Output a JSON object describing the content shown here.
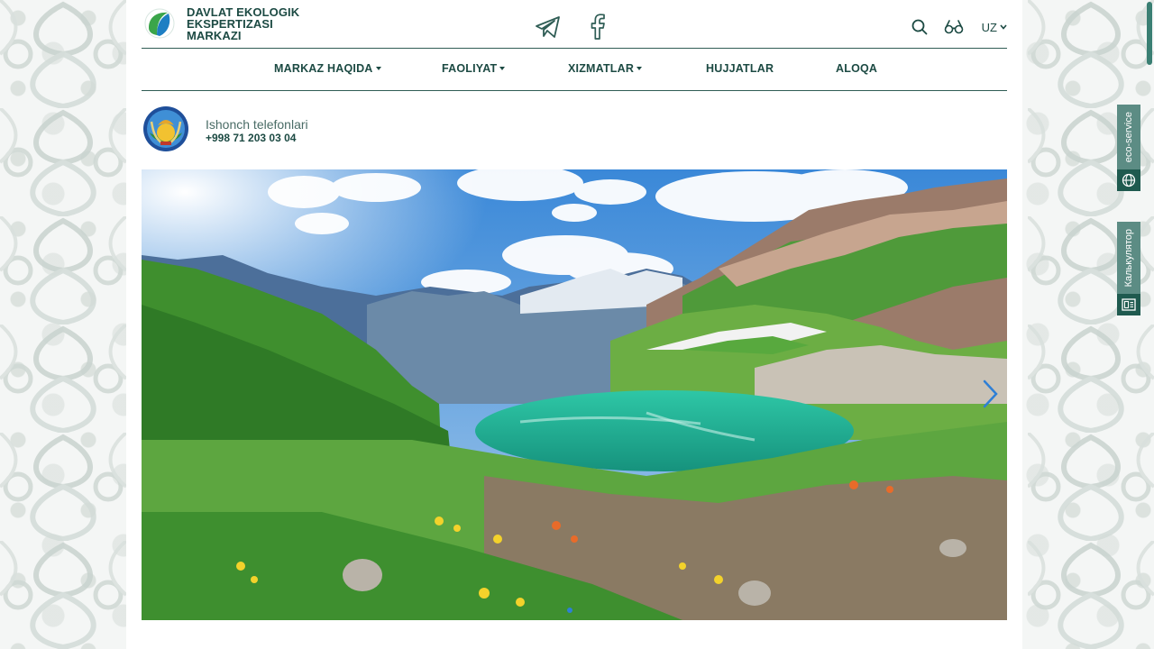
{
  "header": {
    "brand_lines": [
      "DAVLAT EKOLOGIK",
      "EKSPERTIZASI",
      "MARKAZI"
    ],
    "language": "UZ"
  },
  "nav": {
    "items": [
      {
        "label": "MARKAZ HAQIDA",
        "dropdown": true
      },
      {
        "label": "FAOLIYAT",
        "dropdown": true
      },
      {
        "label": "XIZMATLAR",
        "dropdown": true
      },
      {
        "label": "HUJJATLAR",
        "dropdown": false
      },
      {
        "label": "ALOQA",
        "dropdown": false
      }
    ]
  },
  "hotline": {
    "label": "Ishonch telefonlari",
    "phone": "+998 71 203 03 04"
  },
  "side_tabs": {
    "eco": "eco-service",
    "calc": "Калькулятор"
  },
  "colors": {
    "brand": "#1c4a43",
    "accent": "#5c8c84",
    "dark_accent": "#1f5a4f",
    "carousel_dot": "#2e7fd6"
  },
  "icons": [
    "logo-icon",
    "telegram-icon",
    "facebook-icon",
    "search-icon",
    "glasses-icon",
    "chevron-down-icon",
    "globe-icon",
    "calculator-icon",
    "chevron-right-icon"
  ]
}
